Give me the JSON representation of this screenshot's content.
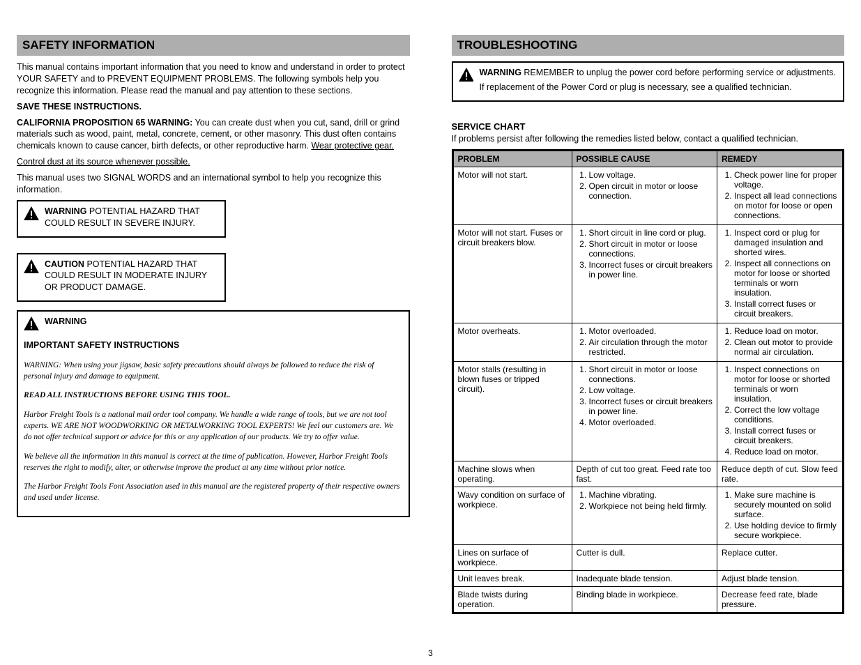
{
  "page_number": "3",
  "left": {
    "header": "SAFETY INFORMATION",
    "intro": "This manual contains important information that you need to know and understand in order to protect YOUR SAFETY and to PREVENT EQUIPMENT PROBLEMS. The following symbols help you recognize this information. Please read the manual and pay attention to these sections.",
    "warning_narrow": {
      "label": "WARNING",
      "text": "POTENTIAL HAZARD THAT COULD RESULT IN SEVERE INJURY."
    },
    "caution_narrow": {
      "label": "CAUTION",
      "text": "POTENTIAL HAZARD THAT COULD RESULT IN MODERATE INJURY OR PRODUCT DAMAGE."
    },
    "assoc_wrap": {
      "label": "WARNING",
      "sig_title": "IMPORTANT SAFETY INSTRUCTIONS",
      "body": "WARNING: When using your jigsaw, basic safety precautions should always be followed to reduce the risk of personal injury and damage to equipment.",
      "read_all": "READ ALL INSTRUCTIONS BEFORE USING THIS TOOL.",
      "p1": "Harbor Freight Tools is a national mail order tool company. We handle a wide range of tools, but we are not tool experts. WE ARE NOT WOODWORKING OR METALWORKING TOOL EXPERTS! We feel our customers are. We do not offer technical support or advice for this or any application of our products. We try to offer value.",
      "p2": "We believe all the information in this manual is correct at the time of publication. However, Harbor Freight Tools reserves the right to modify, alter, or otherwise improve the product at any time without prior notice.",
      "p3": "The Harbor Freight Tools Font Association used in this manual are the registered property of their respective owners and used under license."
    }
  },
  "right": {
    "header": "TROUBLESHOOTING",
    "warning": {
      "label": "WARNING",
      "line1": "REMEMBER to unplug the power cord before performing service or adjustments.",
      "line2": "If replacement of the Power Cord or plug is necessary, see a qualified technician."
    },
    "sc_heading": "SERVICE CHART",
    "sc_sub": "If problems persist after following the remedies listed below, contact a qualified technician.",
    "table": {
      "headers": [
        "PROBLEM",
        "POSSIBLE CAUSE",
        "REMEDY"
      ],
      "rows": [
        {
          "problem": "Motor will not start.",
          "causes": [
            "Low voltage.",
            "Open circuit in motor or loose connection."
          ],
          "remedies": [
            "Check power line for proper voltage.",
            "Inspect all lead connections on motor for loose or open connections."
          ]
        },
        {
          "problem": "Motor will not start. Fuses or circuit breakers blow.",
          "causes": [
            "Short circuit in line cord or plug.",
            "Short circuit in motor or loose connections.",
            "Incorrect fuses or circuit breakers in power line."
          ],
          "remedies": [
            "Inspect cord or plug for damaged insulation and shorted wires.",
            "Inspect all connections on motor for loose or shorted terminals or worn insulation.",
            "Install correct fuses or circuit breakers."
          ]
        },
        {
          "problem": "Motor overheats.",
          "causes": [
            "Motor overloaded.",
            "Air circulation through the motor restricted."
          ],
          "remedies": [
            "Reduce load on motor.",
            "Clean out motor to provide normal air circulation."
          ]
        },
        {
          "problem": "Motor stalls (resulting in blown fuses or tripped circuit).",
          "causes": [
            "Short circuit in motor or loose connections.",
            "Low voltage.",
            "Incorrect fuses or circuit breakers in power line.",
            "Motor overloaded."
          ],
          "remedies": [
            "Inspect connections on motor for loose or shorted terminals or worn insulation.",
            "Correct the low voltage conditions.",
            "Install correct fuses or circuit breakers.",
            "Reduce load on motor."
          ]
        },
        {
          "problem": "Machine slows when operating.",
          "causes": [
            "Depth of cut too great. Feed rate too fast."
          ],
          "remedies": [
            "Reduce depth of cut. Slow feed rate."
          ]
        },
        {
          "problem": "Wavy condition on surface of workpiece.",
          "causes": [
            "Machine vibrating.",
            "Workpiece not being held firmly."
          ],
          "remedies": [
            "Make sure machine is securely mounted on solid surface.",
            "Use holding device to firmly secure workpiece."
          ]
        },
        {
          "problem": "Lines on surface of workpiece.",
          "causes": [
            "Cutter is dull."
          ],
          "remedies": [
            "Replace cutter."
          ]
        },
        {
          "problem": "Unit leaves break.",
          "causes": [
            "Inadequate blade tension."
          ],
          "remedies": [
            "Adjust blade tension."
          ]
        },
        {
          "problem": "Blade twists during operation.",
          "causes": [
            "Binding blade in workpiece."
          ],
          "remedies": [
            "Decrease feed rate, blade pressure."
          ]
        }
      ]
    }
  }
}
